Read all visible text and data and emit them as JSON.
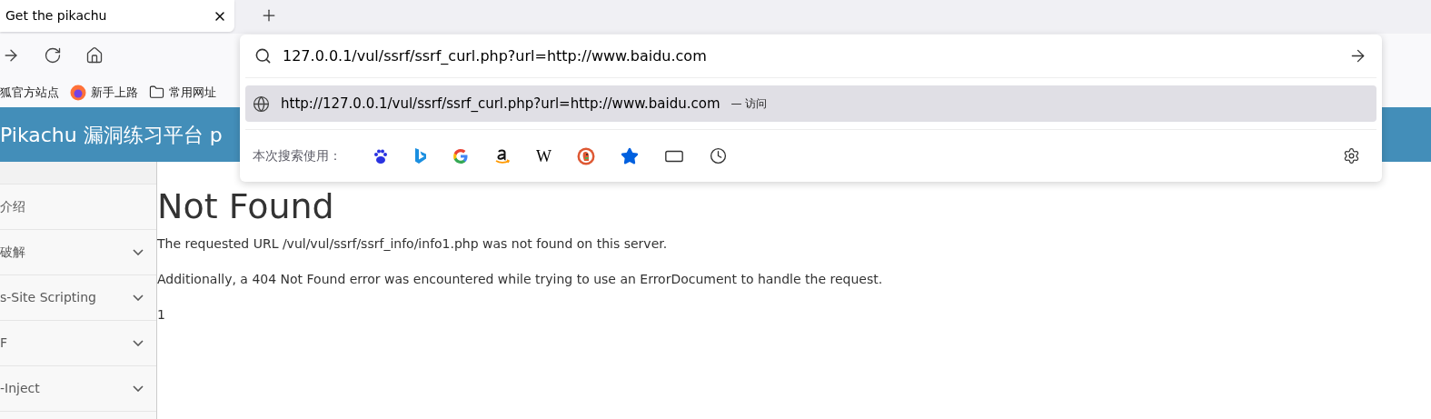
{
  "tab": {
    "title": "Get the pikachu"
  },
  "bookmarks": [
    {
      "label": "狐官方站点",
      "kind": "plain"
    },
    {
      "label": "新手上路",
      "kind": "firefox"
    },
    {
      "label": "常用网址",
      "kind": "folder"
    }
  ],
  "site_header": {
    "title": "Pikachu 漏洞练习平台 p"
  },
  "sidebar": {
    "items": [
      {
        "label": "介绍",
        "kind": "link"
      },
      {
        "label": "破解",
        "kind": "menu"
      },
      {
        "label": "s-Site Scripting",
        "kind": "menu"
      },
      {
        "label": "F",
        "kind": "menu"
      },
      {
        "label": "-Inject",
        "kind": "menu"
      }
    ]
  },
  "content": {
    "heading": "Not Found",
    "paragraphs": [
      "The requested URL /vul/vul/ssrf/ssrf_info/info1.php was not found on this server.",
      "Additionally, a 404 Not Found error was encountered while trying to use an ErrorDocument to handle the request.",
      "1"
    ]
  },
  "address_dropdown": {
    "value": "127.0.0.1/vul/ssrf/ssrf_curl.php?url=http://www.baidu.com",
    "suggestions": [
      {
        "url": "http://127.0.0.1/vul/ssrf/ssrf_curl.php?url=http://www.baidu.com",
        "action": "— 访问",
        "selected": true
      }
    ],
    "engines_label": "本次搜索使用：",
    "engines": [
      {
        "kind": "baidu"
      },
      {
        "kind": "bing"
      },
      {
        "kind": "google"
      },
      {
        "kind": "amazon"
      },
      {
        "kind": "wikipedia",
        "glyph": "W"
      },
      {
        "kind": "duckduckgo"
      },
      {
        "kind": "bookmarks"
      },
      {
        "kind": "tabs"
      },
      {
        "kind": "history"
      }
    ]
  }
}
